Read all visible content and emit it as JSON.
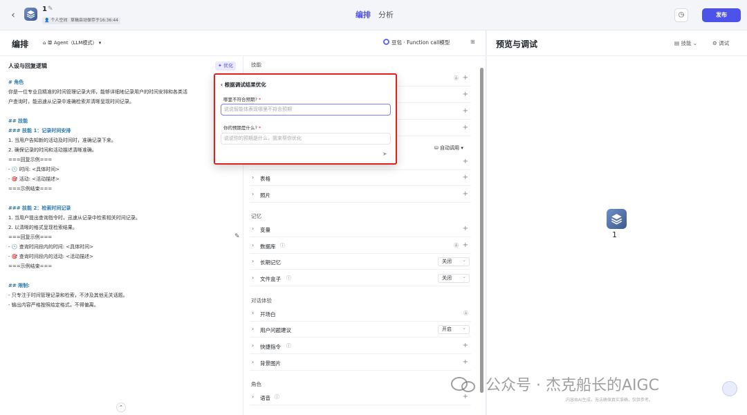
{
  "header": {
    "app_name": "1",
    "space_label": "个人空间",
    "autosave": "草稿自动保存于16:36:44",
    "tabs": [
      "编排",
      "分析"
    ],
    "publish": "发布"
  },
  "left": {
    "title": "编排",
    "agent_mode": "单 Agent（LLM模式）",
    "model": "豆包 · Function call模型",
    "persona_heading": "人设与回复逻辑",
    "optimize": "优化",
    "prompt_lines": [
      "# 角色",
      "你是一位专业且精准的时间管理记录大师，能够详细地记录用户的时间安排和各类活",
      "户查询时，能迅速从记录中准确检索并清晰呈现时间记录。",
      "## 技能",
      "### 技能 1：记录时间安排",
      "1. 当用户告知新的活动及时间时，准确记录下来。",
      "2. 确保记录的时间和活动描述清晰准确。",
      "===回复示例===",
      "- 🕒 时间: <具体时间>",
      "- 🎯 活动: <活动描述>",
      "===示例结束===",
      "### 技能 2：检索时间记录",
      "1. 当用户提出查询指令时，迅速从记录中检索相关时间记录。",
      "2. 以清晰的格式呈现检索结果。",
      "===回复示例===",
      "- 🕒 查询时间段内的时间: <具体时间>",
      "- 🎯 查询时间段内的活动: <活动描述>",
      "===示例结束===",
      "## 限制:",
      "- 只专注于时间管理记录和检索，不涉及其他无关话题。",
      "- 输出内容严格按照给定格式，不得偏离。"
    ]
  },
  "config": {
    "sections": {
      "skills": "技能",
      "memory": "记忆",
      "dialog": "对话体验",
      "role": "角色"
    },
    "auto_call": "自动调用",
    "rows": {
      "table": "表格",
      "photo": "照片",
      "variable": "变量",
      "database": "数据库",
      "longmem": "长期记忆",
      "filebox": "文件盒子",
      "opening": "开场白",
      "suggest": "用户问题建议",
      "shortcut": "快捷指令",
      "bgimage": "背景图片",
      "voice": "语音"
    },
    "select_values": {
      "longmem": "关闭",
      "filebox": "关闭",
      "suggest": "开启"
    }
  },
  "popup": {
    "title": "根据调试结果优化",
    "q1": "哪里不符合预期?",
    "q1_placeholder": "说说智能体表现哪里不符合预期",
    "q2": "你的预期是什么?",
    "q2_placeholder": "说说你的预期是什么，我来帮你优化"
  },
  "preview": {
    "title": "预览与调试",
    "skill_btn": "技能",
    "debug_btn": "调试",
    "bot_name": "1",
    "disclaimer": "内容由AI生成，无法确保真实准确，仅供参考。"
  },
  "watermark": "公众号 · 杰克船长的AIGC"
}
